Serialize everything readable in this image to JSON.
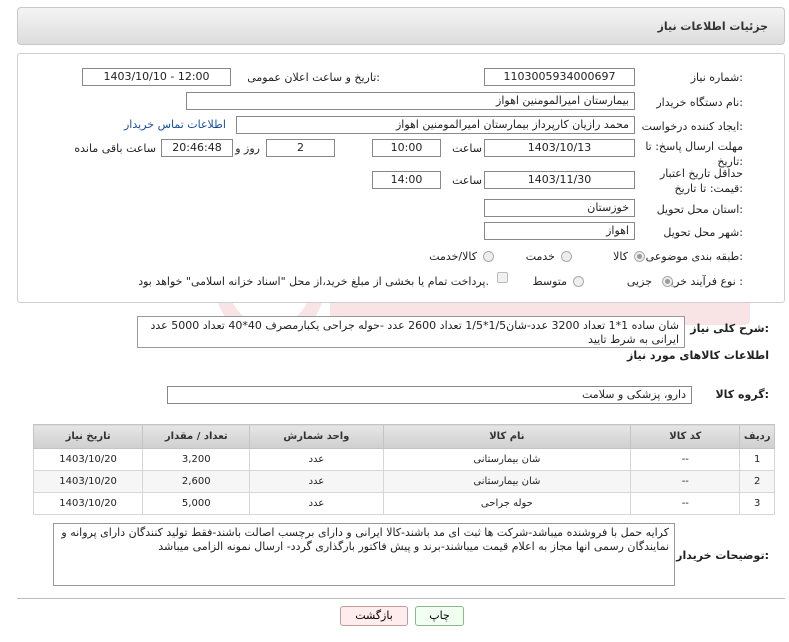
{
  "header": {
    "title": "جزئیات اطلاعات نیاز"
  },
  "fields": {
    "need_number_label": "شماره نیاز:",
    "need_number": "1103005934000697",
    "announce_label": "تاریخ و ساعت اعلان عمومی:",
    "announce_value": "1403/10/10 - 12:00",
    "buyer_org_label": "نام دستگاه خریدار:",
    "buyer_org": "بیمارستان امیرالمومنین اهواز",
    "creator_label": "ایجاد کننده درخواست:",
    "creator": "محمد رازیان کارپرداز بیمارستان امیرالمومنین اهواز",
    "contact_link": "اطلاعات تماس خریدار",
    "reply_deadline_label": "مهلت ارسال پاسخ: تا تاریخ:",
    "reply_date": "1403/10/13",
    "time_label": "ساعت",
    "reply_time": "10:00",
    "days_value": "2",
    "days_label": "روز و",
    "remaining_time": "20:46:48",
    "remaining_label": "ساعت باقی مانده",
    "validity_label": "حداقل تاریخ اعتبار قیمت: تا تاریخ:",
    "validity_date": "1403/11/30",
    "validity_time_label": "ساعت",
    "validity_time": "14:00",
    "province_label": "استان محل تحویل:",
    "province": "خوزستان",
    "city_label": "شهر محل تحویل:",
    "city": "اهواز",
    "category_label": "طبقه بندی موضوعی:",
    "category_options": [
      "کالا",
      "خدمت",
      "کالا/خدمت"
    ],
    "process_label": "نوع فرآیند خرید :",
    "process_options": [
      "جزیی",
      "متوسط"
    ],
    "payment_note": "پرداخت تمام یا بخشی از مبلغ خرید،از محل \"اسناد خزانه اسلامی\" خواهد بود."
  },
  "summary": {
    "label": "شرح کلی نیاز:",
    "text": "شان ساده 1*1 تعداد 3200 عدد-شان1/5*1/5 تعداد 2600 عدد -حوله جراحی یکبارمصرف 40*40 تعداد 5000 عدد ایرانی به شرط تایید"
  },
  "goods": {
    "section_title": "اطلاعات کالاهای مورد نیاز",
    "group_label": "گروه کالا:",
    "group_value": "دارو، پزشکی و سلامت",
    "columns": [
      "ردیف",
      "کد کالا",
      "نام کالا",
      "واحد شمارش",
      "تعداد / مقدار",
      "تاریخ نیاز"
    ],
    "rows": [
      {
        "row": "1",
        "code": "--",
        "name": "شان بیمارستانی",
        "unit": "عدد",
        "qty": "3,200",
        "date": "1403/10/20"
      },
      {
        "row": "2",
        "code": "--",
        "name": "شان بیمارستانی",
        "unit": "عدد",
        "qty": "2,600",
        "date": "1403/10/20"
      },
      {
        "row": "3",
        "code": "--",
        "name": "حوله جراحی",
        "unit": "عدد",
        "qty": "5,000",
        "date": "1403/10/20"
      }
    ]
  },
  "buyer_notes": {
    "label": "توضیحات خریدار:",
    "text": "کرایه حمل با فروشنده میباشد-شرکت ها ثبت ای مد باشند-کالا ایرانی و دارای برچسب اصالت باشند-فقط تولید کنندگان دارای پروانه و نمایندگان رسمی انها مجاز به اعلام قیمت میباشند-برند و پیش فاکتور بارگذاری گردد- ارسال نمونه الزامی میباشد"
  },
  "buttons": {
    "print": "چاپ",
    "back": "بازگشت"
  },
  "colors": {
    "link": "#1a4fa0",
    "header_bg": "#dcdcdc"
  }
}
